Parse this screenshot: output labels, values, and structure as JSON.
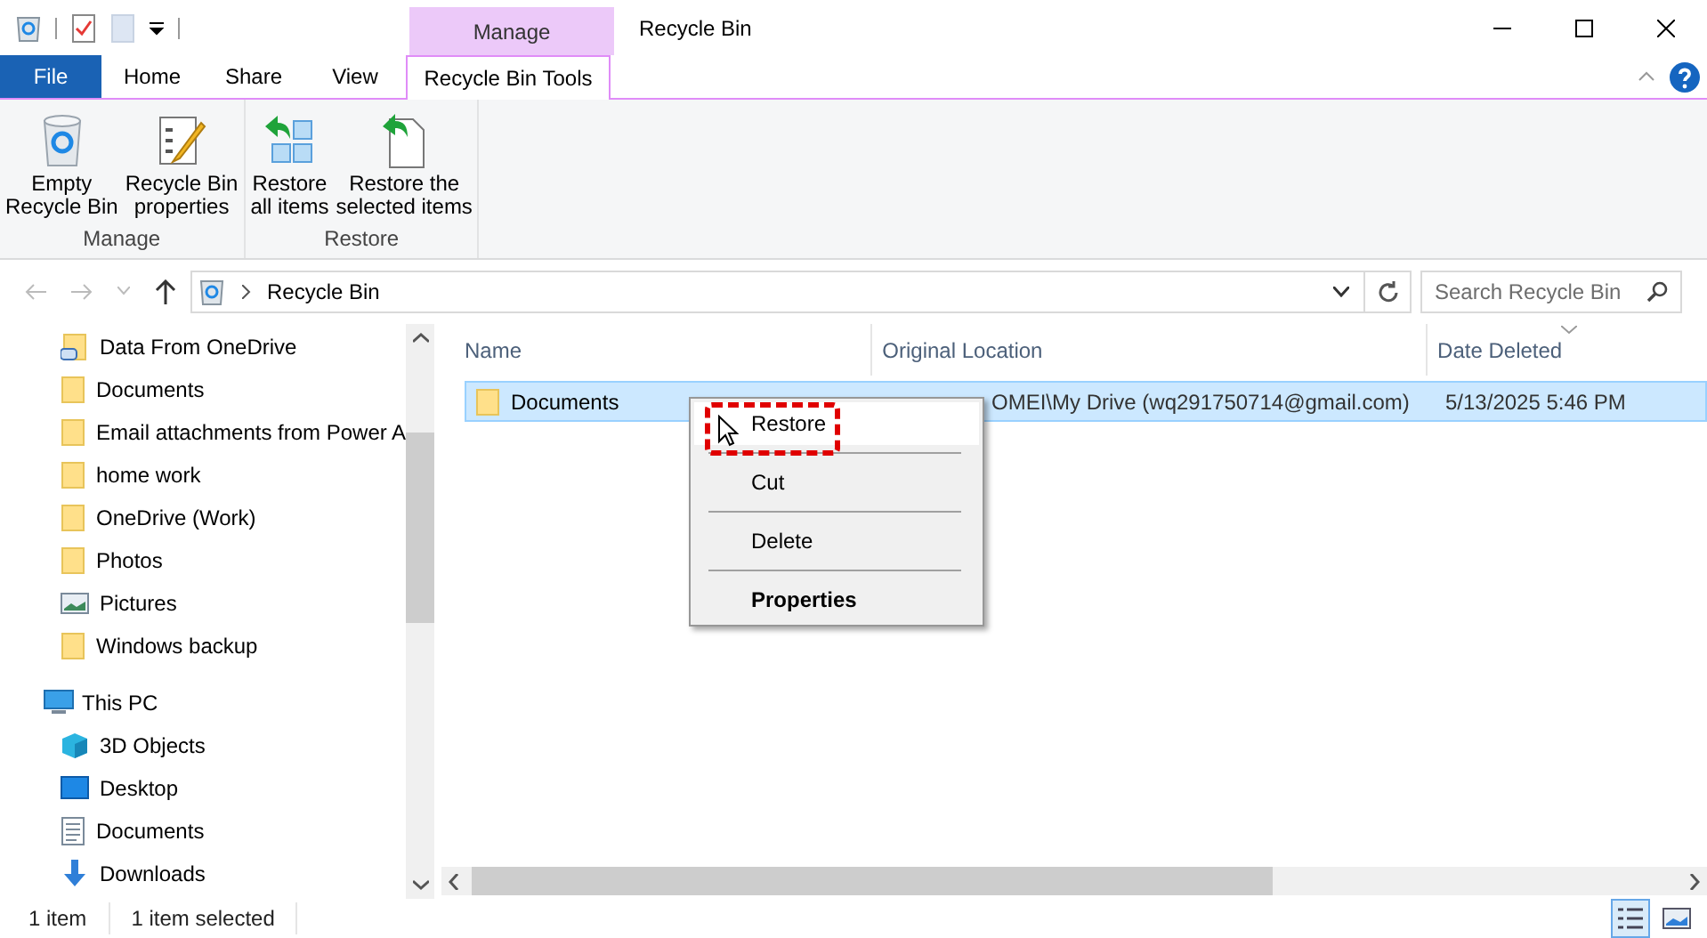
{
  "window": {
    "title": "Recycle Bin",
    "context_tab_group": "Manage"
  },
  "tabs": [
    {
      "label": "File",
      "kind": "file",
      "selected": false
    },
    {
      "label": "Home",
      "kind": "tab",
      "selected": false
    },
    {
      "label": "Share",
      "kind": "tab",
      "selected": false
    },
    {
      "label": "View",
      "kind": "tab",
      "selected": false
    },
    {
      "label": "Recycle Bin Tools",
      "kind": "context",
      "selected": true
    }
  ],
  "ribbon": {
    "groups": [
      {
        "label": "Manage",
        "buttons": [
          {
            "lines": [
              "Empty",
              "Recycle Bin"
            ],
            "kind": "bin"
          },
          {
            "lines": [
              "Recycle Bin",
              "properties"
            ],
            "kind": "properties"
          }
        ]
      },
      {
        "label": "Restore",
        "buttons": [
          {
            "lines": [
              "Restore",
              "all items"
            ],
            "kind": "restore-all"
          },
          {
            "lines": [
              "Restore the",
              "selected items"
            ],
            "kind": "restore-selected"
          }
        ]
      }
    ]
  },
  "address": {
    "path": "Recycle Bin"
  },
  "search": {
    "placeholder": "Search Recycle Bin"
  },
  "nav": {
    "scrolled_items": [
      {
        "label": "Data From OneDrive",
        "kind": "linked-folder"
      },
      {
        "label": "Documents",
        "kind": "folder"
      },
      {
        "label": "Email attachments from Power A",
        "kind": "folder"
      },
      {
        "label": "home work",
        "kind": "folder"
      },
      {
        "label": "OneDrive (Work)",
        "kind": "folder"
      },
      {
        "label": "Photos",
        "kind": "folder"
      },
      {
        "label": "Pictures",
        "kind": "pictures"
      },
      {
        "label": "Windows backup",
        "kind": "folder"
      }
    ],
    "tree": [
      {
        "label": "This PC",
        "kind": "pc",
        "children": [
          {
            "label": "3D Objects",
            "kind": "objects"
          },
          {
            "label": "Desktop",
            "kind": "desktop"
          },
          {
            "label": "Documents",
            "kind": "documents"
          },
          {
            "label": "Downloads",
            "kind": "downloads"
          }
        ]
      }
    ]
  },
  "table": {
    "columns": [
      {
        "label": "Name",
        "sorted": false
      },
      {
        "label": "Original Location",
        "sorted": false
      },
      {
        "label": "Date Deleted",
        "sorted": true
      }
    ],
    "rows": [
      {
        "name": "Documents",
        "original_location": "OMEI\\My Drive (wq291750714@gmail.com)",
        "date_deleted": "5/13/2025 5:46 PM",
        "selected": true
      }
    ]
  },
  "context_menu": {
    "items": [
      {
        "label": "Restore",
        "highlighted": true,
        "default": false
      },
      {
        "label": "Cut",
        "highlighted": false,
        "default": false
      },
      {
        "label": "Delete",
        "highlighted": false,
        "default": false
      },
      {
        "label": "Properties",
        "highlighted": false,
        "default": true
      }
    ]
  },
  "status_bar": {
    "item_count": "1 item",
    "selection": "1 item selected"
  },
  "views": [
    {
      "kind": "details",
      "selected": true
    },
    {
      "kind": "large-icons",
      "selected": false
    }
  ]
}
